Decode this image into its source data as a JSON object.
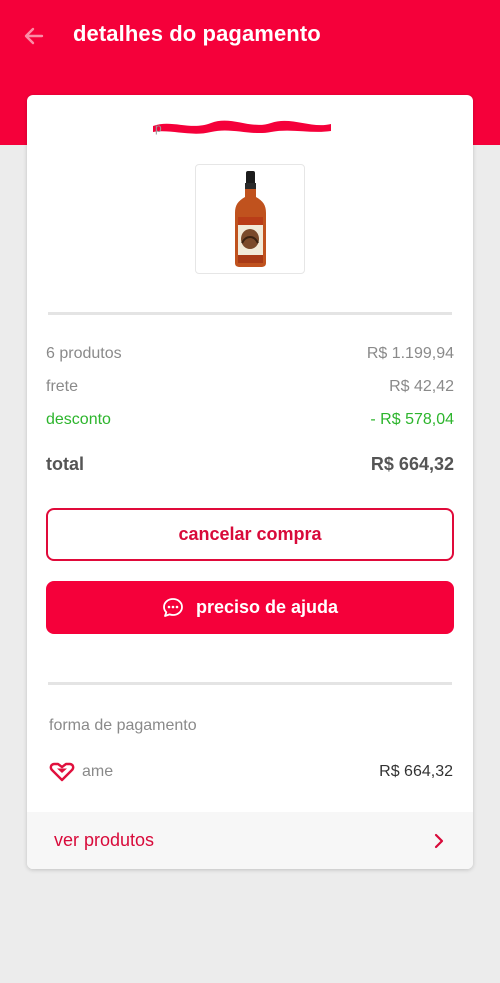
{
  "header": {
    "title": "detalhes do pagamento",
    "back_icon": "arrow-left-icon",
    "background_color": "#f5003a"
  },
  "product": {
    "image": "whiskey-bottle"
  },
  "summary": {
    "items": [
      {
        "label": "6 produtos",
        "value": "R$ 1.199,94"
      },
      {
        "label": "frete",
        "value": "R$ 42,42"
      },
      {
        "label": "desconto",
        "value": "- R$ 578,04",
        "color": "#2db52d"
      }
    ],
    "total_label": "total",
    "total_value": "R$ 664,32"
  },
  "actions": {
    "cancel_label": "cancelar compra",
    "help_label": "preciso de ajuda",
    "help_icon": "chat-bubble-icon"
  },
  "payment": {
    "section_label": "forma de pagamento",
    "method_icon": "ame-heart-icon",
    "method_name": "ame",
    "amount": "R$ 664,32"
  },
  "footer": {
    "view_products_label": "ver produtos",
    "chevron_icon": "chevron-right-icon"
  }
}
